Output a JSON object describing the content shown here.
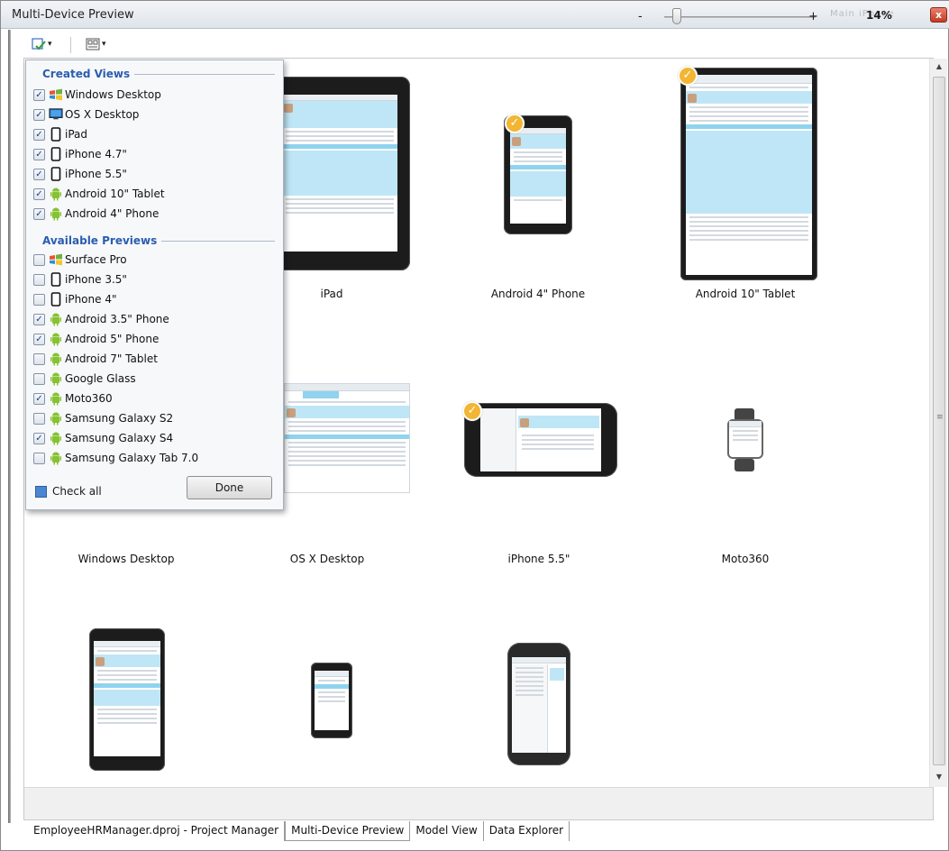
{
  "window": {
    "title": "Multi-Device Preview",
    "close_label": "x",
    "faded_title": "Main   iPhone"
  },
  "toolbar": {
    "views_button": "views-selector",
    "layout_button": "layout-selector"
  },
  "panel": {
    "created_header": "Created Views",
    "available_header": "Available Previews",
    "created": [
      {
        "label": "Windows Desktop",
        "checked": true,
        "icon": "windows-icon"
      },
      {
        "label": "OS X Desktop",
        "checked": true,
        "icon": "monitor-icon"
      },
      {
        "label": "iPad",
        "checked": true,
        "icon": "phone-outline-icon"
      },
      {
        "label": "iPhone 4.7\"",
        "checked": true,
        "icon": "phone-outline-icon"
      },
      {
        "label": "iPhone 5.5\"",
        "checked": true,
        "icon": "phone-outline-icon"
      },
      {
        "label": "Android 10\" Tablet",
        "checked": true,
        "icon": "android-icon"
      },
      {
        "label": "Android 4\" Phone",
        "checked": true,
        "icon": "android-icon"
      }
    ],
    "available": [
      {
        "label": "Surface Pro",
        "checked": false,
        "icon": "windows-icon"
      },
      {
        "label": "iPhone 3.5\"",
        "checked": false,
        "icon": "phone-outline-icon"
      },
      {
        "label": "iPhone 4\"",
        "checked": false,
        "icon": "phone-outline-icon"
      },
      {
        "label": "Android 3.5\" Phone",
        "checked": true,
        "icon": "android-icon"
      },
      {
        "label": "Android 5\" Phone",
        "checked": true,
        "icon": "android-icon"
      },
      {
        "label": "Android 7\" Tablet",
        "checked": false,
        "icon": "android-icon"
      },
      {
        "label": "Google Glass",
        "checked": false,
        "icon": "android-icon"
      },
      {
        "label": "Moto360",
        "checked": true,
        "icon": "android-icon"
      },
      {
        "label": "Samsung Galaxy S2",
        "checked": false,
        "icon": "android-icon"
      },
      {
        "label": "Samsung Galaxy S4",
        "checked": true,
        "icon": "android-icon"
      },
      {
        "label": "Samsung Galaxy Tab 7.0",
        "checked": false,
        "icon": "android-icon"
      }
    ],
    "check_all_label": "Check all",
    "done_label": "Done"
  },
  "previews": [
    {
      "label": "iPad",
      "selected": false
    },
    {
      "label": "Android 4\" Phone",
      "selected": true
    },
    {
      "label": "Android 10\" Tablet",
      "selected": true
    },
    {
      "label": "Windows Desktop",
      "selected": false
    },
    {
      "label": "OS X Desktop",
      "selected": false
    },
    {
      "label": "iPhone 5.5\"",
      "selected": true
    },
    {
      "label": "Moto360",
      "selected": false
    }
  ],
  "zoom": {
    "minus": "-",
    "plus": "+",
    "level": "14%",
    "fraction": 0.03
  },
  "tabs": [
    {
      "label": "EmployeeHRManager.dproj - Project Manager",
      "active": false
    },
    {
      "label": "Multi-Device Preview",
      "active": true
    },
    {
      "label": "Model View",
      "active": false
    },
    {
      "label": "Data Explorer",
      "active": false
    }
  ],
  "colors": {
    "accent": "#2a5db0",
    "badge": "#f2b632",
    "screen_blue": "#bfe6f6"
  }
}
